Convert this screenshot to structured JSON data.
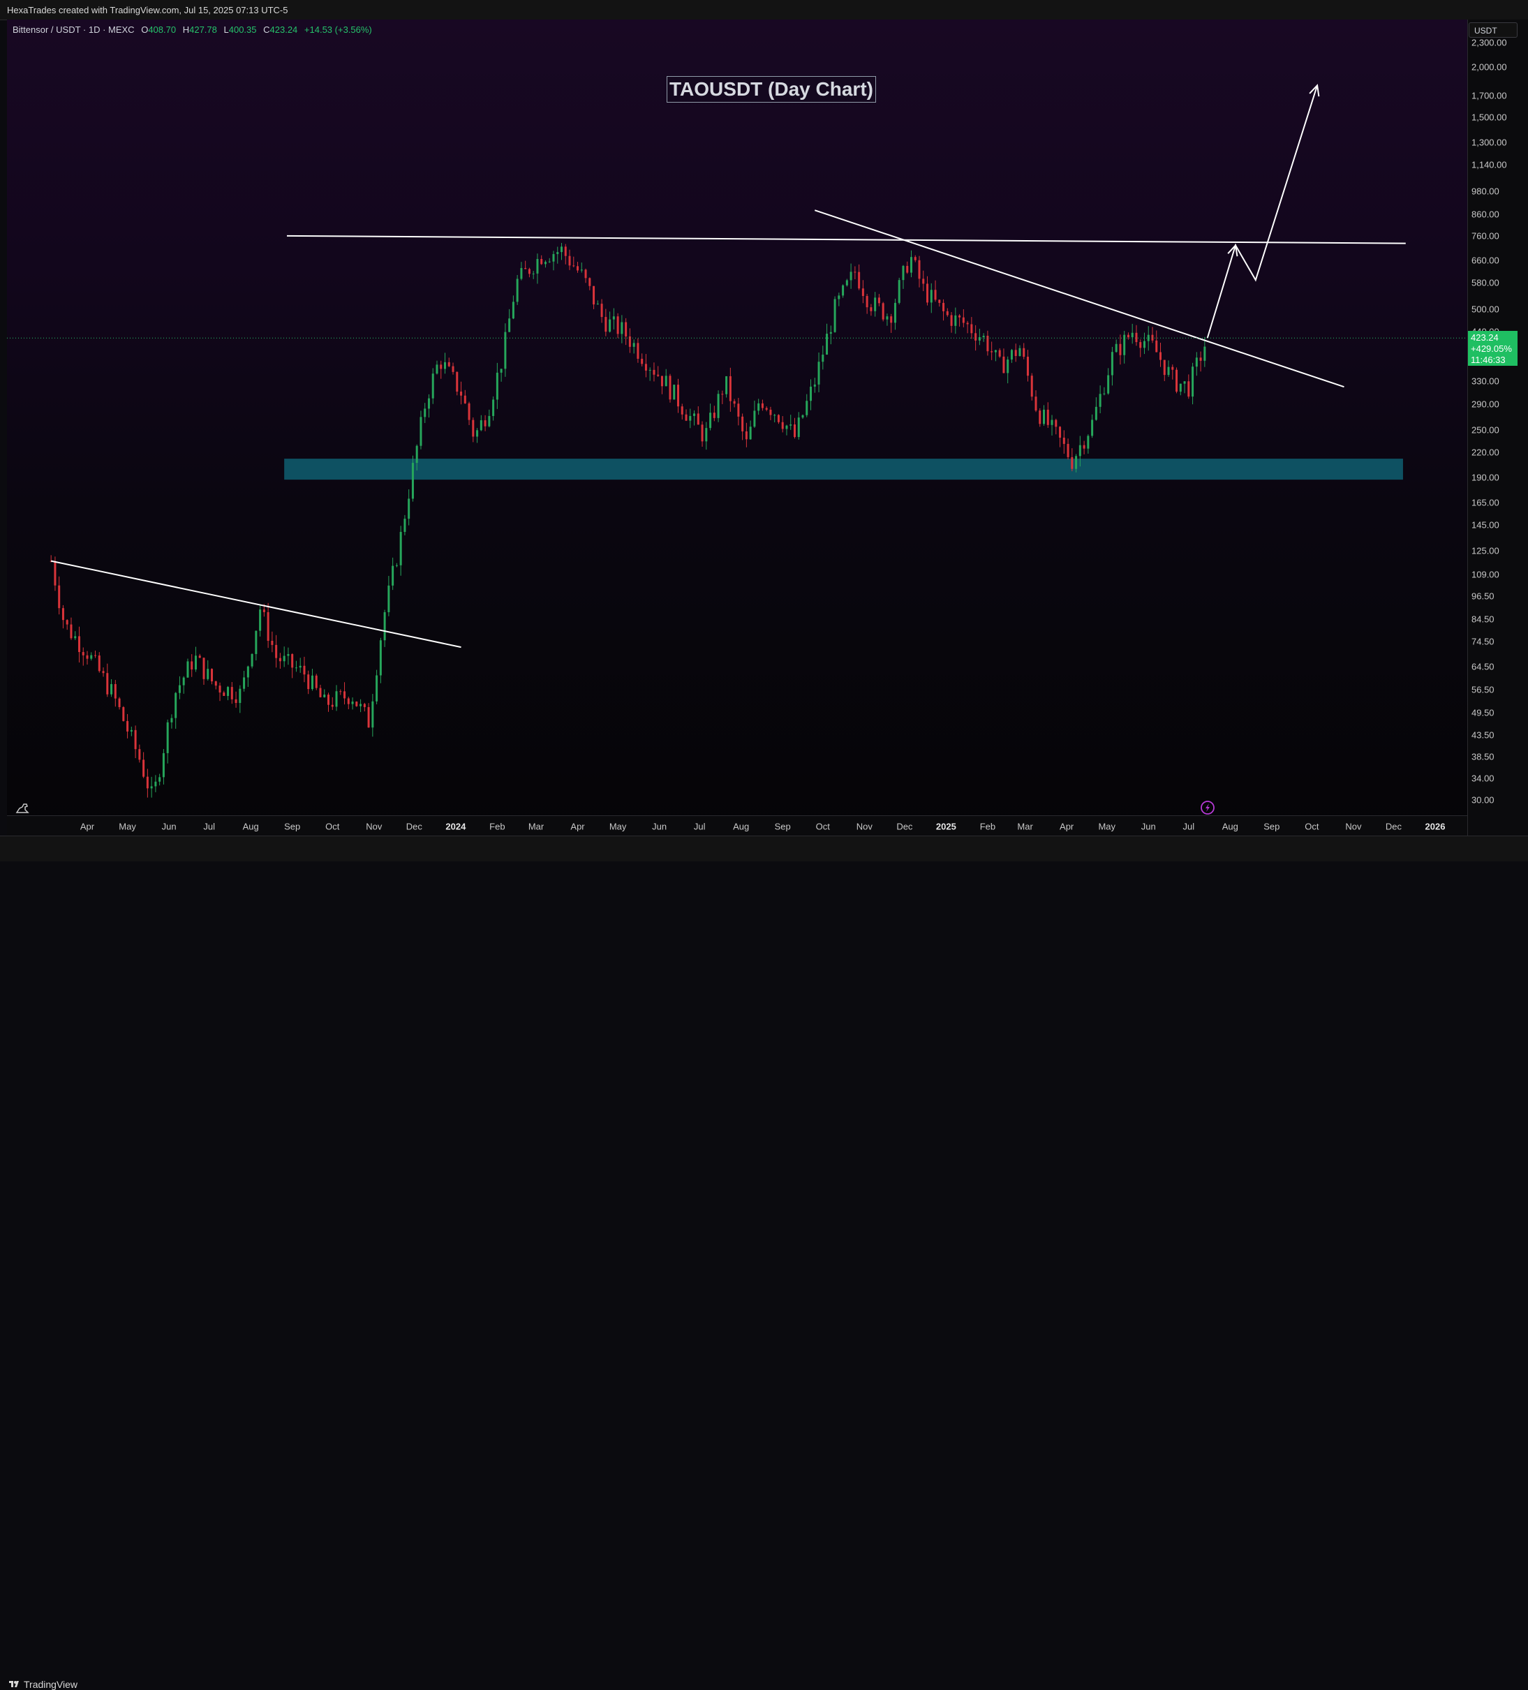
{
  "header": {
    "credit": "HexaTrades created with TradingView.com, Jul 15, 2025 07:13 UTC-5"
  },
  "legend": {
    "symbol": "Bittensor / USDT · 1D · MEXC",
    "open_label": "O",
    "open": "408.70",
    "high_label": "H",
    "high": "427.78",
    "low_label": "L",
    "low": "400.35",
    "close_label": "C",
    "close": "423.24",
    "change": "+14.53 (+3.56%)"
  },
  "annotation": "TAOUSDT (Day Chart)",
  "price_axis": {
    "currency": "USDT",
    "last_price": "423.24",
    "last_change": "+429.05%",
    "countdown": "11:46:33"
  },
  "footer": {
    "brand": "TradingView"
  },
  "icons": [
    "tradingview-logo-icon",
    "dino-icon",
    "lightning-icon"
  ],
  "colors": {
    "bull": "#26a65b",
    "bear": "#d9343a",
    "support_zone": "#0e5a6b",
    "trendline": "#ffffff",
    "last_price": "#1fbf62"
  },
  "chart_data": {
    "type": "candlestick",
    "title": "TAOUSDT (Day Chart)",
    "scale": "log",
    "ylim": [
      28,
      2400
    ],
    "y_ticks": [
      30,
      34,
      38.5,
      43.5,
      49.5,
      56.5,
      64.5,
      74.5,
      84.5,
      96.5,
      109,
      125,
      145,
      165,
      190,
      220,
      250,
      290,
      330,
      440,
      500,
      580,
      660,
      760,
      860,
      980,
      1140,
      1300,
      1500,
      1700,
      2000,
      2300
    ],
    "y_tick_labels": [
      "30.00",
      "34.00",
      "38.50",
      "43.50",
      "49.50",
      "56.50",
      "64.50",
      "74.50",
      "84.50",
      "96.50",
      "109.00",
      "125.00",
      "145.00",
      "165.00",
      "190.00",
      "220.00",
      "250.00",
      "290.00",
      "330.00",
      "440.00",
      "500.00",
      "580.00",
      "660.00",
      "760.00",
      "860.00",
      "980.00",
      "1,140.00",
      "1,300.00",
      "1,500.00",
      "1,700.00",
      "2,000.00",
      "2,300.00"
    ],
    "x_ticks": [
      {
        "label": "Apr",
        "date": "2023-04-01"
      },
      {
        "label": "May",
        "date": "2023-05-01"
      },
      {
        "label": "Jun",
        "date": "2023-06-01"
      },
      {
        "label": "Jul",
        "date": "2023-07-01"
      },
      {
        "label": "Aug",
        "date": "2023-08-01"
      },
      {
        "label": "Sep",
        "date": "2023-09-01"
      },
      {
        "label": "Oct",
        "date": "2023-10-01"
      },
      {
        "label": "Nov",
        "date": "2023-11-01"
      },
      {
        "label": "Dec",
        "date": "2023-12-01"
      },
      {
        "label": "2024",
        "date": "2024-01-01",
        "year": true
      },
      {
        "label": "Feb",
        "date": "2024-02-01"
      },
      {
        "label": "Mar",
        "date": "2024-03-01"
      },
      {
        "label": "Apr",
        "date": "2024-04-01"
      },
      {
        "label": "May",
        "date": "2024-05-01"
      },
      {
        "label": "Jun",
        "date": "2024-06-01"
      },
      {
        "label": "Jul",
        "date": "2024-07-01"
      },
      {
        "label": "Aug",
        "date": "2024-08-01"
      },
      {
        "label": "Sep",
        "date": "2024-09-01"
      },
      {
        "label": "Oct",
        "date": "2024-10-01"
      },
      {
        "label": "Nov",
        "date": "2024-11-01"
      },
      {
        "label": "Dec",
        "date": "2024-12-01"
      },
      {
        "label": "2025",
        "date": "2025-01-01",
        "year": true
      },
      {
        "label": "Feb",
        "date": "2025-02-01"
      },
      {
        "label": "Mar",
        "date": "2025-03-01"
      },
      {
        "label": "Apr",
        "date": "2025-04-01"
      },
      {
        "label": "May",
        "date": "2025-05-01"
      },
      {
        "label": "Jun",
        "date": "2025-06-01"
      },
      {
        "label": "Jul",
        "date": "2025-07-01"
      },
      {
        "label": "Aug",
        "date": "2025-08-01"
      },
      {
        "label": "Sep",
        "date": "2025-09-01"
      },
      {
        "label": "Oct",
        "date": "2025-10-01"
      },
      {
        "label": "Nov",
        "date": "2025-11-01"
      },
      {
        "label": "Dec",
        "date": "2025-12-01"
      },
      {
        "label": "2026",
        "date": "2026-01-01",
        "year": true
      }
    ],
    "price_path": [
      [
        "2023-03-05",
        118
      ],
      [
        "2023-03-15",
        82
      ],
      [
        "2023-04-01",
        70
      ],
      [
        "2023-04-20",
        55
      ],
      [
        "2023-05-10",
        38
      ],
      [
        "2023-05-20",
        30
      ],
      [
        "2023-06-05",
        55
      ],
      [
        "2023-06-20",
        68
      ],
      [
        "2023-07-05",
        58
      ],
      [
        "2023-07-25",
        55
      ],
      [
        "2023-08-08",
        90
      ],
      [
        "2023-08-20",
        68
      ],
      [
        "2023-09-10",
        62
      ],
      [
        "2023-09-25",
        52
      ],
      [
        "2023-10-15",
        55
      ],
      [
        "2023-10-28",
        47
      ],
      [
        "2023-11-08",
        85
      ],
      [
        "2023-11-20",
        130
      ],
      [
        "2023-11-30",
        200
      ],
      [
        "2023-12-10",
        300
      ],
      [
        "2023-12-20",
        375
      ],
      [
        "2024-01-05",
        310
      ],
      [
        "2024-01-15",
        240
      ],
      [
        "2024-01-25",
        280
      ],
      [
        "2024-02-05",
        380
      ],
      [
        "2024-02-15",
        580
      ],
      [
        "2024-03-05",
        680
      ],
      [
        "2024-03-20",
        700
      ],
      [
        "2024-04-05",
        600
      ],
      [
        "2024-04-20",
        470
      ],
      [
        "2024-05-05",
        440
      ],
      [
        "2024-05-20",
        380
      ],
      [
        "2024-06-05",
        330
      ],
      [
        "2024-06-20",
        280
      ],
      [
        "2024-07-05",
        240
      ],
      [
        "2024-07-20",
        330
      ],
      [
        "2024-08-05",
        230
      ],
      [
        "2024-08-15",
        300
      ],
      [
        "2024-08-30",
        270
      ],
      [
        "2024-09-10",
        240
      ],
      [
        "2024-09-25",
        330
      ],
      [
        "2024-10-10",
        500
      ],
      [
        "2024-10-25",
        620
      ],
      [
        "2024-11-05",
        520
      ],
      [
        "2024-11-20",
        480
      ],
      [
        "2024-12-05",
        680
      ],
      [
        "2024-12-15",
        560
      ],
      [
        "2025-01-01",
        480
      ],
      [
        "2025-01-15",
        460
      ],
      [
        "2025-01-30",
        420
      ],
      [
        "2025-02-10",
        360
      ],
      [
        "2025-02-25",
        400
      ],
      [
        "2025-03-10",
        280
      ],
      [
        "2025-03-25",
        240
      ],
      [
        "2025-04-05",
        210
      ],
      [
        "2025-04-20",
        260
      ],
      [
        "2025-05-05",
        380
      ],
      [
        "2025-05-20",
        440
      ],
      [
        "2025-06-05",
        400
      ],
      [
        "2025-06-20",
        330
      ],
      [
        "2025-07-01",
        320
      ],
      [
        "2025-07-15",
        423
      ]
    ],
    "support_zone": {
      "from": "2023-08-26",
      "to": "2025-12-08",
      "low": 188,
      "high": 212
    },
    "trendlines": [
      {
        "from": [
          "2023-03-05",
          118
        ],
        "to": [
          "2024-01-05",
          72
        ]
      },
      {
        "from": [
          "2023-08-28",
          760
        ],
        "to": [
          "2025-12-10",
          728
        ]
      },
      {
        "from": [
          "2024-09-25",
          880
        ],
        "to": [
          "2025-10-25",
          320
        ]
      }
    ],
    "projection": [
      [
        "2025-07-15",
        423
      ],
      [
        "2025-08-05",
        720
      ],
      [
        "2025-08-20",
        590
      ],
      [
        "2025-10-05",
        1800
      ]
    ],
    "last_price": 423.24,
    "interval": "1D",
    "exchange": "MEXC"
  }
}
